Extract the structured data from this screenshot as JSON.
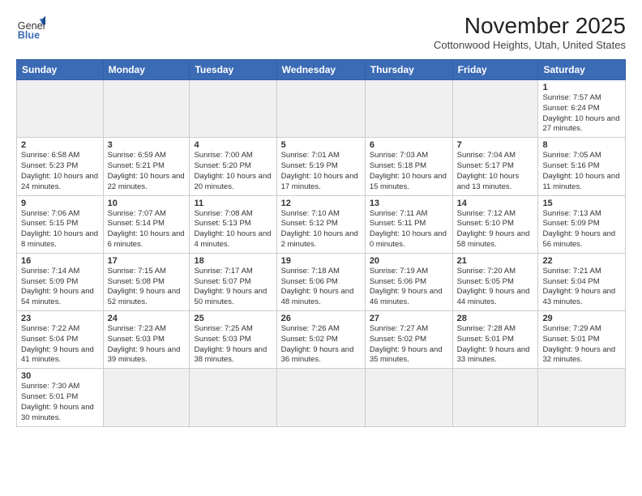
{
  "header": {
    "logo_general": "General",
    "logo_blue": "Blue",
    "month_title": "November 2025",
    "subtitle": "Cottonwood Heights, Utah, United States"
  },
  "days_of_week": [
    "Sunday",
    "Monday",
    "Tuesday",
    "Wednesday",
    "Thursday",
    "Friday",
    "Saturday"
  ],
  "weeks": [
    [
      {
        "day": "",
        "info": "",
        "empty": true
      },
      {
        "day": "",
        "info": "",
        "empty": true
      },
      {
        "day": "",
        "info": "",
        "empty": true
      },
      {
        "day": "",
        "info": "",
        "empty": true
      },
      {
        "day": "",
        "info": "",
        "empty": true
      },
      {
        "day": "",
        "info": "",
        "empty": true
      },
      {
        "day": "1",
        "info": "Sunrise: 7:57 AM\nSunset: 6:24 PM\nDaylight: 10 hours and 27 minutes."
      }
    ],
    [
      {
        "day": "2",
        "info": "Sunrise: 6:58 AM\nSunset: 5:23 PM\nDaylight: 10 hours and 24 minutes."
      },
      {
        "day": "3",
        "info": "Sunrise: 6:59 AM\nSunset: 5:21 PM\nDaylight: 10 hours and 22 minutes."
      },
      {
        "day": "4",
        "info": "Sunrise: 7:00 AM\nSunset: 5:20 PM\nDaylight: 10 hours and 20 minutes."
      },
      {
        "day": "5",
        "info": "Sunrise: 7:01 AM\nSunset: 5:19 PM\nDaylight: 10 hours and 17 minutes."
      },
      {
        "day": "6",
        "info": "Sunrise: 7:03 AM\nSunset: 5:18 PM\nDaylight: 10 hours and 15 minutes."
      },
      {
        "day": "7",
        "info": "Sunrise: 7:04 AM\nSunset: 5:17 PM\nDaylight: 10 hours and 13 minutes."
      },
      {
        "day": "8",
        "info": "Sunrise: 7:05 AM\nSunset: 5:16 PM\nDaylight: 10 hours and 11 minutes."
      }
    ],
    [
      {
        "day": "9",
        "info": "Sunrise: 7:06 AM\nSunset: 5:15 PM\nDaylight: 10 hours and 8 minutes."
      },
      {
        "day": "10",
        "info": "Sunrise: 7:07 AM\nSunset: 5:14 PM\nDaylight: 10 hours and 6 minutes."
      },
      {
        "day": "11",
        "info": "Sunrise: 7:08 AM\nSunset: 5:13 PM\nDaylight: 10 hours and 4 minutes."
      },
      {
        "day": "12",
        "info": "Sunrise: 7:10 AM\nSunset: 5:12 PM\nDaylight: 10 hours and 2 minutes."
      },
      {
        "day": "13",
        "info": "Sunrise: 7:11 AM\nSunset: 5:11 PM\nDaylight: 10 hours and 0 minutes."
      },
      {
        "day": "14",
        "info": "Sunrise: 7:12 AM\nSunset: 5:10 PM\nDaylight: 9 hours and 58 minutes."
      },
      {
        "day": "15",
        "info": "Sunrise: 7:13 AM\nSunset: 5:09 PM\nDaylight: 9 hours and 56 minutes."
      }
    ],
    [
      {
        "day": "16",
        "info": "Sunrise: 7:14 AM\nSunset: 5:09 PM\nDaylight: 9 hours and 54 minutes."
      },
      {
        "day": "17",
        "info": "Sunrise: 7:15 AM\nSunset: 5:08 PM\nDaylight: 9 hours and 52 minutes."
      },
      {
        "day": "18",
        "info": "Sunrise: 7:17 AM\nSunset: 5:07 PM\nDaylight: 9 hours and 50 minutes."
      },
      {
        "day": "19",
        "info": "Sunrise: 7:18 AM\nSunset: 5:06 PM\nDaylight: 9 hours and 48 minutes."
      },
      {
        "day": "20",
        "info": "Sunrise: 7:19 AM\nSunset: 5:06 PM\nDaylight: 9 hours and 46 minutes."
      },
      {
        "day": "21",
        "info": "Sunrise: 7:20 AM\nSunset: 5:05 PM\nDaylight: 9 hours and 44 minutes."
      },
      {
        "day": "22",
        "info": "Sunrise: 7:21 AM\nSunset: 5:04 PM\nDaylight: 9 hours and 43 minutes."
      }
    ],
    [
      {
        "day": "23",
        "info": "Sunrise: 7:22 AM\nSunset: 5:04 PM\nDaylight: 9 hours and 41 minutes."
      },
      {
        "day": "24",
        "info": "Sunrise: 7:23 AM\nSunset: 5:03 PM\nDaylight: 9 hours and 39 minutes."
      },
      {
        "day": "25",
        "info": "Sunrise: 7:25 AM\nSunset: 5:03 PM\nDaylight: 9 hours and 38 minutes."
      },
      {
        "day": "26",
        "info": "Sunrise: 7:26 AM\nSunset: 5:02 PM\nDaylight: 9 hours and 36 minutes."
      },
      {
        "day": "27",
        "info": "Sunrise: 7:27 AM\nSunset: 5:02 PM\nDaylight: 9 hours and 35 minutes."
      },
      {
        "day": "28",
        "info": "Sunrise: 7:28 AM\nSunset: 5:01 PM\nDaylight: 9 hours and 33 minutes."
      },
      {
        "day": "29",
        "info": "Sunrise: 7:29 AM\nSunset: 5:01 PM\nDaylight: 9 hours and 32 minutes."
      }
    ],
    [
      {
        "day": "30",
        "info": "Sunrise: 7:30 AM\nSunset: 5:01 PM\nDaylight: 9 hours and 30 minutes.",
        "last": true
      },
      {
        "day": "",
        "info": "",
        "empty": true,
        "last": true
      },
      {
        "day": "",
        "info": "",
        "empty": true,
        "last": true
      },
      {
        "day": "",
        "info": "",
        "empty": true,
        "last": true
      },
      {
        "day": "",
        "info": "",
        "empty": true,
        "last": true
      },
      {
        "day": "",
        "info": "",
        "empty": true,
        "last": true
      },
      {
        "day": "",
        "info": "",
        "empty": true,
        "last": true
      }
    ]
  ]
}
